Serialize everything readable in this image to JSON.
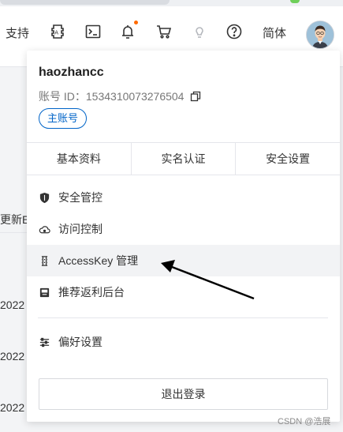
{
  "topbar": {
    "support_label": "支持",
    "lang_label": "简体",
    "icons": [
      "api-icon",
      "terminal-icon",
      "bell-icon",
      "cart-icon",
      "bulb-icon",
      "help-icon"
    ]
  },
  "background": {
    "table_header_fragment": "更新E",
    "year_fragments": [
      "2022",
      "2022",
      "2022"
    ]
  },
  "panel": {
    "username": "haozhancc",
    "account_label": "账号 ID：",
    "account_id": "1534310073276504",
    "role_tag": "主账号",
    "tabs": [
      {
        "label": "基本资料"
      },
      {
        "label": "实名认证"
      },
      {
        "label": "安全设置"
      }
    ],
    "menu": [
      {
        "label": "安全管控",
        "icon": "shield-icon"
      },
      {
        "label": "访问控制",
        "icon": "cloud-icon"
      },
      {
        "label": "AccessKey 管理",
        "icon": "key-icon"
      },
      {
        "label": "推荐返利后台",
        "icon": "card-icon"
      },
      {
        "label": "偏好设置",
        "icon": "sliders-icon"
      }
    ],
    "logout_label": "退出登录"
  },
  "watermark": "CSDN @浩展",
  "colors": {
    "accent": "#0064c8",
    "notification_dot": "#ff6a00",
    "annotation_arrow": "#000000"
  }
}
